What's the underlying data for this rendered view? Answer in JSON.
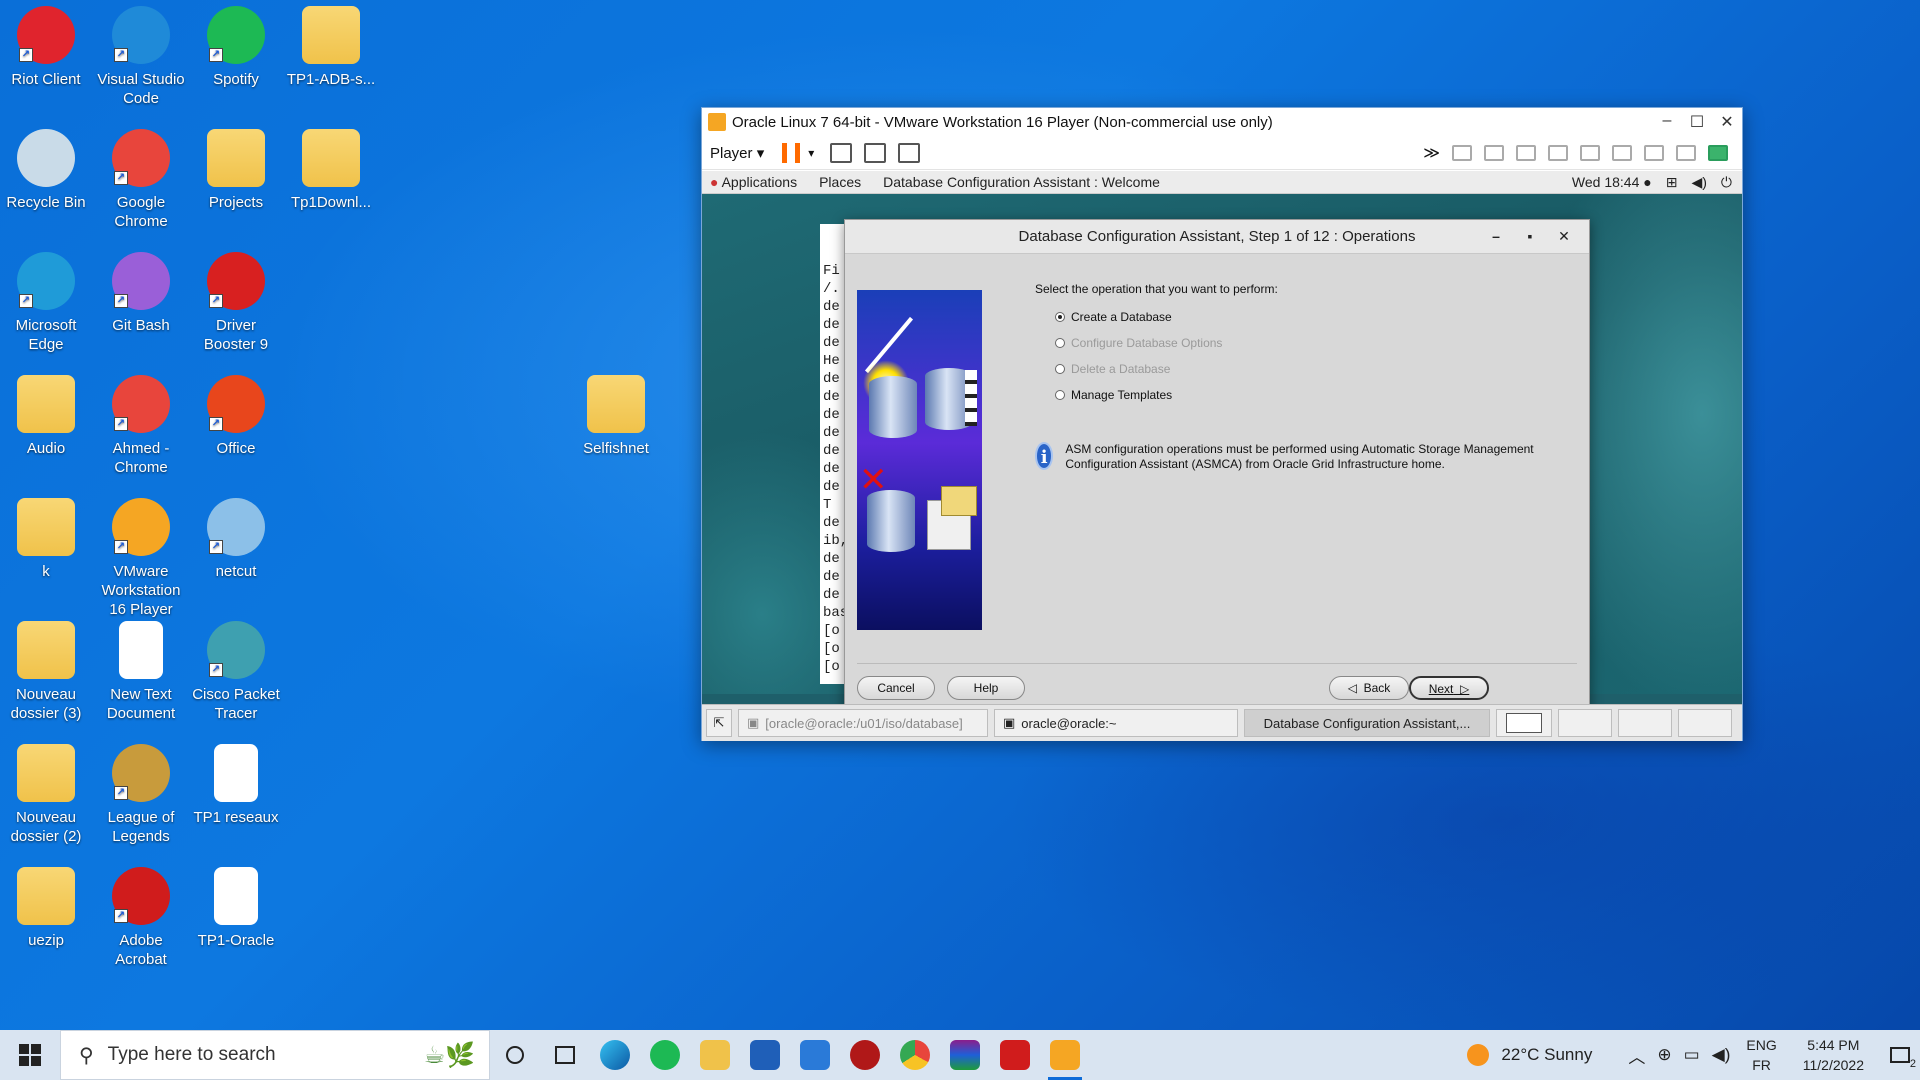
{
  "desktop": {
    "icons": [
      {
        "label": "Riot Client",
        "color": "#e0242d"
      },
      {
        "label": "Visual Studio Code",
        "color": "#1f8ad8"
      },
      {
        "label": "Spotify",
        "color": "#1db954"
      },
      {
        "label": "TP1-ADB-s...",
        "color": "#f0c24a"
      },
      {
        "label": "Recycle Bin",
        "color": "#c9dbe8"
      },
      {
        "label": "Google Chrome",
        "color": "#e8453c"
      },
      {
        "label": "Projects",
        "color": "#f0c24a"
      },
      {
        "label": "Tp1Downl...",
        "color": "#f0c24a"
      },
      {
        "label": "Microsoft Edge",
        "color": "#1f9bd8"
      },
      {
        "label": "Git Bash",
        "color": "#9a5fd8"
      },
      {
        "label": "Driver Booster 9",
        "color": "#d82020"
      },
      {
        "label": "Audio",
        "color": "#f0c24a"
      },
      {
        "label": "Ahmed - Chrome",
        "color": "#e8453c"
      },
      {
        "label": "Office",
        "color": "#e8461c"
      },
      {
        "label": "k",
        "color": "#f0c24a"
      },
      {
        "label": "VMware Workstation 16 Player",
        "color": "#f5a623"
      },
      {
        "label": "netcut",
        "color": "#8cc0e8"
      },
      {
        "label": "Nouveau dossier (3)",
        "color": "#f0c24a"
      },
      {
        "label": "New Text Document",
        "color": "#ffffff"
      },
      {
        "label": "Cisco Packet Tracer",
        "color": "#3ea0b0"
      },
      {
        "label": "Nouveau dossier (2)",
        "color": "#f0c24a"
      },
      {
        "label": "League of Legends",
        "color": "#c89b3c"
      },
      {
        "label": "TP1 reseaux",
        "color": "#ffffff"
      },
      {
        "label": "uezip",
        "color": "#f0c24a"
      },
      {
        "label": "Adobe Acrobat",
        "color": "#d01c1c"
      },
      {
        "label": "TP1-Oracle",
        "color": "#ffffff"
      },
      {
        "label": "Selfishnet",
        "color": "#f0c24a"
      }
    ]
  },
  "vmware": {
    "title": "Oracle Linux 7 64-bit - VMware Workstation 16 Player (Non-commercial use only)",
    "player_menu": "Player",
    "gnome": {
      "applications": "Applications",
      "places": "Places",
      "window_title": "Database Configuration Assistant : Welcome",
      "clock": "Wed 18:44"
    },
    "terminal_lines": [
      "Fi",
      "/.",
      "de",
      "de",
      "de",
      "He",
      "de",
      "de",
      "de",
      "de",
      "de",
      "de",
      "de",
      "T",
      "de",
      "ib,",
      "de",
      "de",
      "de",
      "bas",
      "[o",
      "[o",
      "[o"
    ],
    "dca": {
      "title": "Database Configuration Assistant, Step 1 of 12 : Operations",
      "prompt": "Select the operation that you want to perform:",
      "options": [
        {
          "label": "Create a Database",
          "selected": true,
          "enabled": true
        },
        {
          "label": "Configure Database Options",
          "selected": false,
          "enabled": false
        },
        {
          "label": "Delete a Database",
          "selected": false,
          "enabled": false
        },
        {
          "label": "Manage Templates",
          "selected": false,
          "enabled": true
        }
      ],
      "info_text": "ASM configuration operations must be performed using Automatic Storage Management Configuration Assistant (ASMCA) from Oracle Grid Infrastructure home.",
      "buttons": {
        "cancel": "Cancel",
        "help": "Help",
        "back": "Back",
        "next": "Next"
      }
    },
    "guest_taskbar": {
      "items": [
        "[oracle@oracle:/u01/iso/database]",
        "oracle@oracle:~",
        "Database Configuration Assistant,..."
      ]
    }
  },
  "taskbar": {
    "search_placeholder": "Type here to search",
    "weather": "22°C  Sunny",
    "lang_top": "ENG",
    "lang_bottom": "FR",
    "time": "5:44 PM",
    "date": "11/2/2022",
    "notif_count": "2"
  }
}
